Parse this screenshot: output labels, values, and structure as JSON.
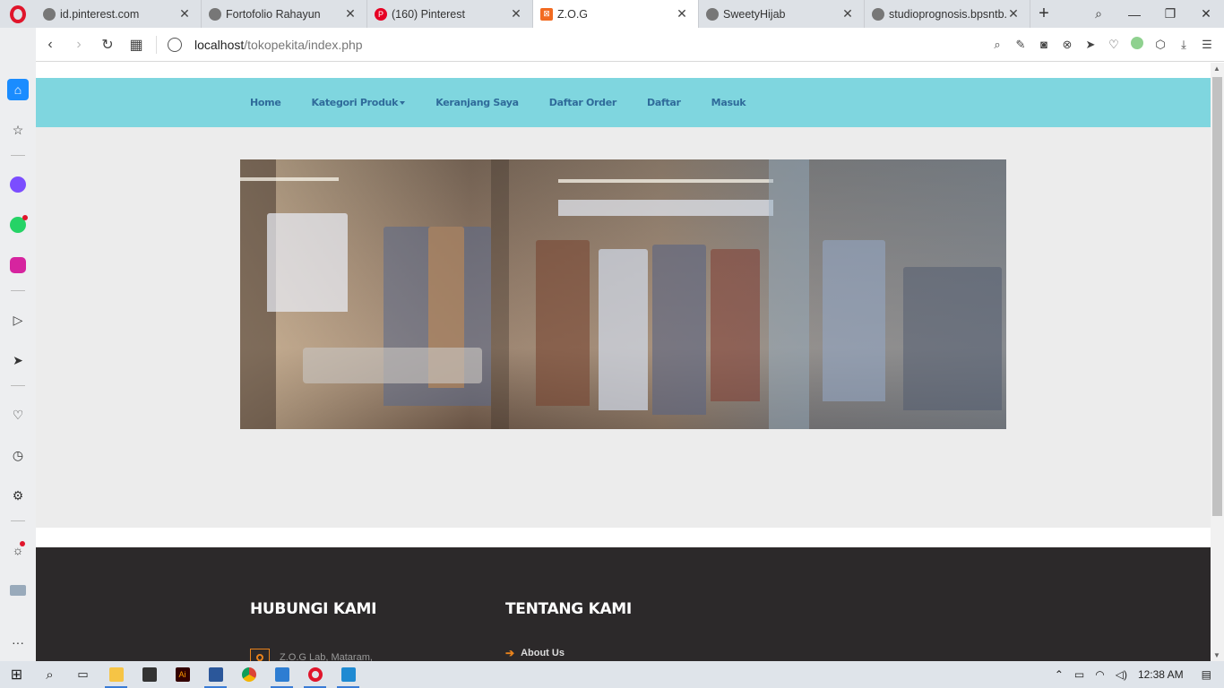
{
  "browser": {
    "tabs": [
      {
        "title": "id.pinterest.com",
        "active": false
      },
      {
        "title": "Fortofolio Rahayun",
        "active": false
      },
      {
        "title": "(160) Pinterest",
        "active": false
      },
      {
        "title": "Z.O.G",
        "active": true
      },
      {
        "title": "SweetyHijab",
        "active": false
      },
      {
        "title": "studioprognosis.bpsntb.",
        "active": false
      }
    ],
    "url_host": "localhost",
    "url_path": "/tokopekita/index.php"
  },
  "site": {
    "nav": [
      {
        "label": "Home"
      },
      {
        "label": "Kategori Produk",
        "dropdown": true
      },
      {
        "label": "Keranjang Saya"
      },
      {
        "label": "Daftar Order"
      },
      {
        "label": "Daftar"
      },
      {
        "label": "Masuk"
      }
    ],
    "footer": {
      "contact_heading": "HUBUNGI KAMI",
      "contact_address": "Z.O.G Lab, Mataram,",
      "about_heading": "TENTANG KAMI",
      "about_link": "About Us"
    }
  },
  "taskbar": {
    "time": "12:38 AM"
  },
  "colors": {
    "navbar_bg": "#7fd6df",
    "nav_text": "#2f6b9a",
    "footer_bg": "#2c292a",
    "accent": "#e8821c"
  }
}
